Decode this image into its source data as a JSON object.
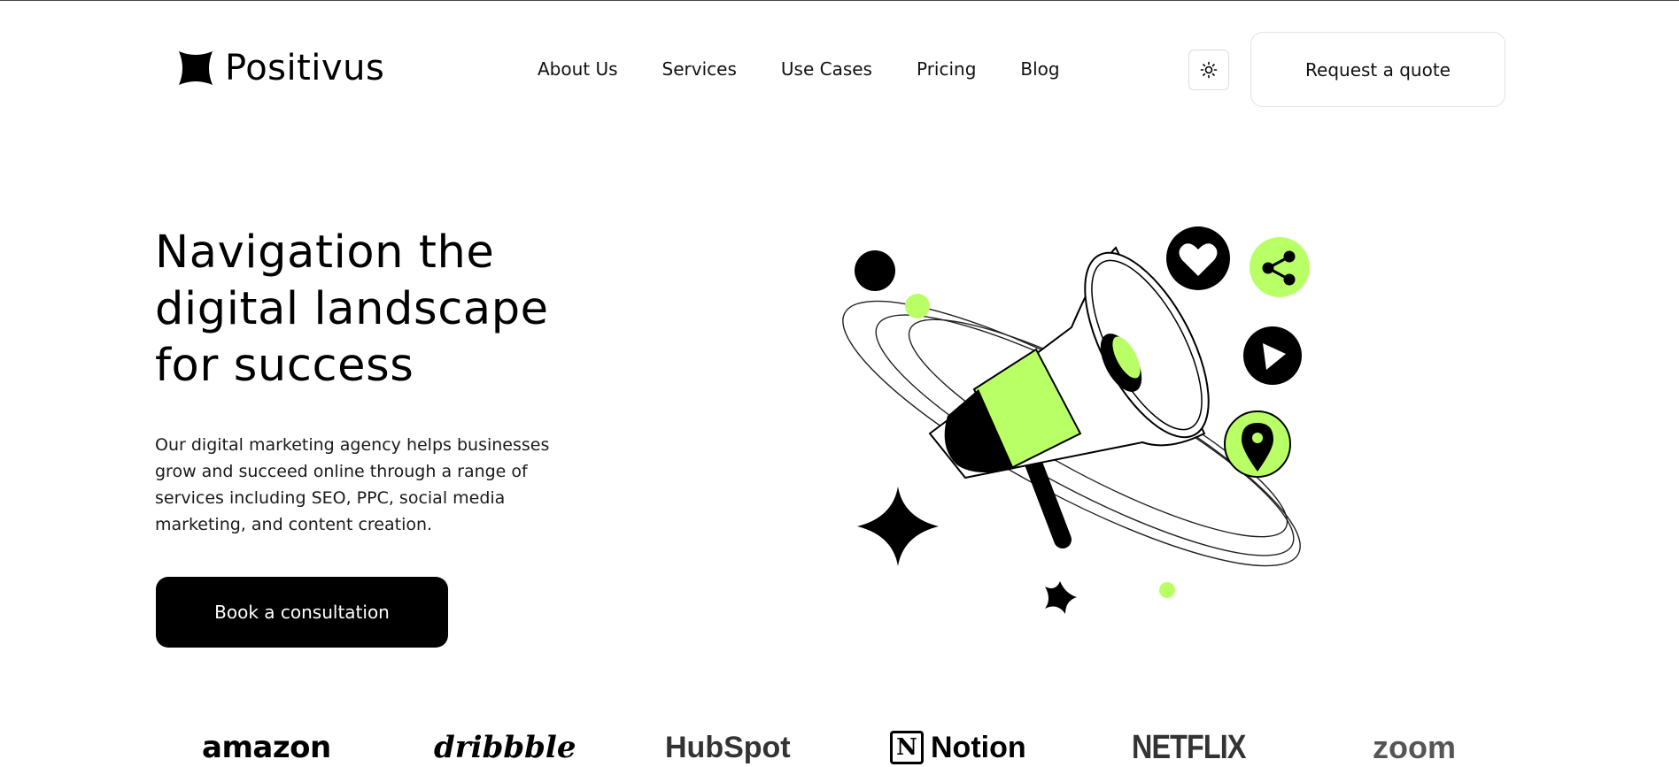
{
  "header": {
    "brand": "Positivus",
    "nav": [
      "About Us",
      "Services",
      "Use Cases",
      "Pricing",
      "Blog"
    ],
    "theme_icon": "sun-icon",
    "quote_label": "Request a quote"
  },
  "hero": {
    "title_lines": [
      "Navigation the",
      "digital landscape",
      "for success"
    ],
    "description": "Our digital marketing agency helps businesses grow and succeed online through a range of services including SEO, PPC, social media marketing, and content creation.",
    "cta_label": "Book a consultation",
    "illustration_icons": [
      "megaphone-icon",
      "heart-icon",
      "share-icon",
      "play-icon",
      "location-pin-icon",
      "sparkle-star-icon"
    ]
  },
  "brands": [
    "amazon",
    "dribbble",
    "HubSpot",
    "Notion",
    "NETFLIX",
    "zoom"
  ],
  "colors": {
    "accent": "#B9FF66",
    "dark": "#000000",
    "background": "#FFFFFF"
  }
}
